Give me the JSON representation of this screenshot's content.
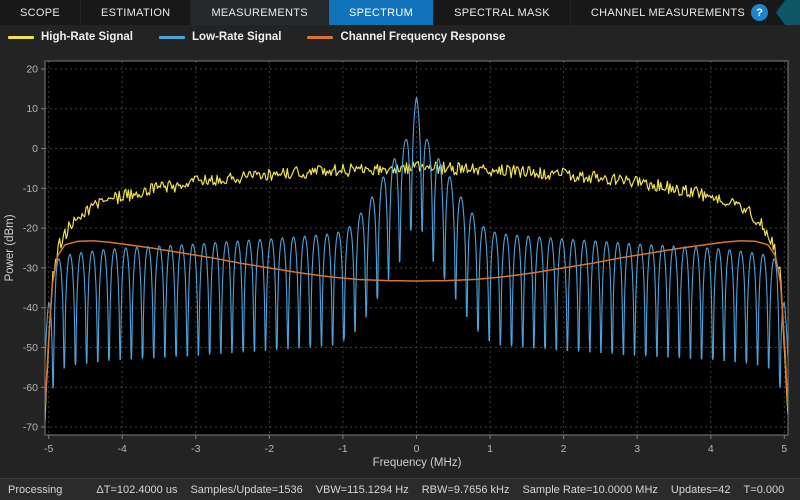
{
  "toolbar": {
    "tabs": [
      {
        "label": "SCOPE",
        "state": "normal"
      },
      {
        "label": "ESTIMATION",
        "state": "normal"
      },
      {
        "label": "MEASUREMENTS",
        "state": "highlight"
      },
      {
        "label": "SPECTRUM",
        "state": "active"
      },
      {
        "label": "SPECTRAL MASK",
        "state": "normal"
      },
      {
        "label": "CHANNEL MEASUREMENTS",
        "state": "normal"
      }
    ],
    "help_label": "?"
  },
  "legend": {
    "items": [
      {
        "label": "High-Rate Signal",
        "color": "#f0e14e"
      },
      {
        "label": "Low-Rate Signal",
        "color": "#4da3dc"
      },
      {
        "label": "Channel Frequency Response",
        "color": "#d9752e"
      }
    ]
  },
  "status_bar": {
    "state": "Processing",
    "stats": [
      "ΔT=102.4000 us",
      "Samples/Update=1536",
      "VBW=115.1294 Hz",
      "RBW=9.7656 kHz",
      "Sample Rate=10.0000 MHz",
      "Updates=42",
      "T=0.000"
    ]
  },
  "chart_data": {
    "type": "line",
    "title": "",
    "xlabel": "Frequency (MHz)",
    "ylabel": "Power (dBm)",
    "xlim": [
      -5,
      5
    ],
    "ylim": [
      -70,
      20
    ],
    "xlim_display": [
      -5.05,
      5.05
    ],
    "ylim_display": [
      -72,
      22
    ],
    "xticks": [
      -5,
      -4,
      -3,
      -2,
      -1,
      0,
      1,
      2,
      3,
      4,
      5
    ],
    "yticks": [
      20,
      10,
      0,
      -10,
      -20,
      -30,
      -40,
      -50,
      -60,
      -70
    ],
    "grid": true,
    "legend_position": "top",
    "noise_seed": 20240913,
    "colors": {
      "plot_bg": "#000000",
      "grid": "#3e3e3e",
      "axis_box": "#7d7d7d",
      "tick_text": "#b8b8b8",
      "axis_label": "#cfcfcf"
    },
    "series": [
      {
        "name": "High-Rate Signal",
        "color": "#f0e14e",
        "kind": "noisy-envelope",
        "step": 0.018,
        "noise_db": 1.6,
        "envelope": [
          [
            -5.05,
            -68
          ],
          [
            -5.0,
            -50
          ],
          [
            -4.95,
            -32
          ],
          [
            -4.85,
            -24
          ],
          [
            -4.7,
            -19
          ],
          [
            -4.5,
            -15.5
          ],
          [
            -4.2,
            -13
          ],
          [
            -4.0,
            -12
          ],
          [
            -3.5,
            -10
          ],
          [
            -3.0,
            -8.5
          ],
          [
            -2.5,
            -7.5
          ],
          [
            -2.0,
            -6.5
          ],
          [
            -1.5,
            -6
          ],
          [
            -1.0,
            -5.5
          ],
          [
            -0.5,
            -5
          ],
          [
            0,
            -4.8
          ],
          [
            0.5,
            -5
          ],
          [
            1.0,
            -5.5
          ],
          [
            1.5,
            -6
          ],
          [
            2.0,
            -6.5
          ],
          [
            2.5,
            -7.5
          ],
          [
            3.0,
            -8.5
          ],
          [
            3.5,
            -10
          ],
          [
            4.0,
            -12
          ],
          [
            4.2,
            -13
          ],
          [
            4.5,
            -15.5
          ],
          [
            4.7,
            -19
          ],
          [
            4.85,
            -24
          ],
          [
            4.95,
            -32
          ],
          [
            5.0,
            -50
          ],
          [
            5.05,
            -68
          ]
        ]
      },
      {
        "name": "Low-Rate Signal",
        "color": "#4da3dc",
        "kind": "comb",
        "step": 0.006,
        "spacing": 0.152,
        "tooth_db": 30,
        "floor_db": -28,
        "envelope": [
          [
            -5.05,
            -50
          ],
          [
            -5.0,
            -38
          ],
          [
            -4.9,
            -28
          ],
          [
            -4.7,
            -26.5
          ],
          [
            -4.3,
            -25.5
          ],
          [
            -4.0,
            -25
          ],
          [
            -3.5,
            -24.5
          ],
          [
            -3.0,
            -24
          ],
          [
            -2.5,
            -23.3
          ],
          [
            -2.0,
            -22.7
          ],
          [
            -1.5,
            -22
          ],
          [
            -1.1,
            -21.3
          ],
          [
            -0.9,
            -19.5
          ],
          [
            -0.75,
            -16
          ],
          [
            -0.6,
            -12
          ],
          [
            -0.45,
            -7
          ],
          [
            -0.3,
            -2.5
          ],
          [
            -0.15,
            2
          ],
          [
            0,
            13
          ],
          [
            0.15,
            2
          ],
          [
            0.3,
            -2.5
          ],
          [
            0.45,
            -7
          ],
          [
            0.6,
            -12
          ],
          [
            0.75,
            -16
          ],
          [
            0.9,
            -19.5
          ],
          [
            1.1,
            -21.3
          ],
          [
            1.5,
            -22
          ],
          [
            2.0,
            -22.7
          ],
          [
            2.5,
            -23.3
          ],
          [
            3.0,
            -24
          ],
          [
            3.5,
            -24.5
          ],
          [
            4.0,
            -25
          ],
          [
            4.3,
            -25.5
          ],
          [
            4.7,
            -26.5
          ],
          [
            4.9,
            -28
          ],
          [
            5.0,
            -38
          ],
          [
            5.05,
            -50
          ]
        ]
      },
      {
        "name": "Channel Frequency Response",
        "color": "#d9752e",
        "kind": "smooth",
        "step": 0.02,
        "points": [
          [
            -5.05,
            -65
          ],
          [
            -5.0,
            -48
          ],
          [
            -4.95,
            -34
          ],
          [
            -4.88,
            -27
          ],
          [
            -4.78,
            -24.2
          ],
          [
            -4.6,
            -23.3
          ],
          [
            -4.4,
            -23.2
          ],
          [
            -4.2,
            -23.5
          ],
          [
            -4.0,
            -24
          ],
          [
            -3.6,
            -25
          ],
          [
            -3.2,
            -26.2
          ],
          [
            -2.8,
            -27.4
          ],
          [
            -2.4,
            -28.8
          ],
          [
            -2.0,
            -30
          ],
          [
            -1.6,
            -31.2
          ],
          [
            -1.2,
            -32.2
          ],
          [
            -0.8,
            -32.9
          ],
          [
            -0.4,
            -33.2
          ],
          [
            0,
            -33.3
          ],
          [
            0.4,
            -33.2
          ],
          [
            0.8,
            -32.9
          ],
          [
            1.2,
            -32.2
          ],
          [
            1.6,
            -31.2
          ],
          [
            2.0,
            -30
          ],
          [
            2.4,
            -28.8
          ],
          [
            2.8,
            -27.4
          ],
          [
            3.2,
            -26.2
          ],
          [
            3.6,
            -25
          ],
          [
            4.0,
            -24
          ],
          [
            4.2,
            -23.5
          ],
          [
            4.4,
            -23.2
          ],
          [
            4.6,
            -23.3
          ],
          [
            4.78,
            -24.2
          ],
          [
            4.88,
            -27
          ],
          [
            4.95,
            -34
          ],
          [
            5.0,
            -48
          ],
          [
            5.05,
            -65
          ]
        ]
      }
    ]
  }
}
